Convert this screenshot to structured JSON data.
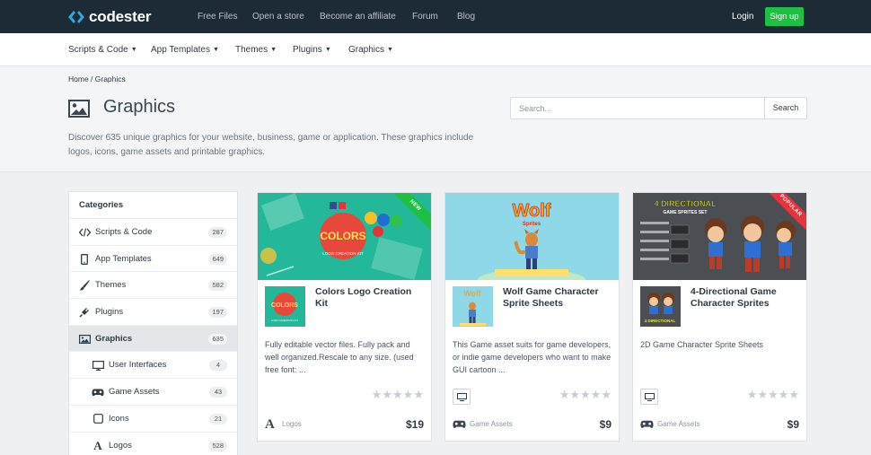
{
  "brand": {
    "name": "codester"
  },
  "topnav": [
    "Free Files",
    "Open a store",
    "Become an affiliate",
    "Forum",
    "Blog"
  ],
  "auth": {
    "login": "Login",
    "signup": "Sign up"
  },
  "menu": [
    "Scripts & Code",
    "App Templates",
    "Themes",
    "Plugins",
    "Graphics"
  ],
  "breadcrumb": "Home / Graphics",
  "page": {
    "title": "Graphics",
    "description": "Discover 635 unique graphics for your website, business, game or application. These graphics include logos, icons, game assets and printable graphics."
  },
  "search": {
    "placeholder": "Search...",
    "button": "Search"
  },
  "sidebar": {
    "title": "Categories",
    "items": [
      {
        "label": "Scripts & Code",
        "count": "287",
        "icon": "code-icon"
      },
      {
        "label": "App Templates",
        "count": "649",
        "icon": "mobile-icon"
      },
      {
        "label": "Themes",
        "count": "582",
        "icon": "brush-icon"
      },
      {
        "label": "Plugins",
        "count": "197",
        "icon": "plug-icon"
      },
      {
        "label": "Graphics",
        "count": "635",
        "icon": "image-icon"
      },
      {
        "label": "User Interfaces",
        "count": "4",
        "icon": "monitor-icon"
      },
      {
        "label": "Game Assets",
        "count": "43",
        "icon": "gamepad-icon"
      },
      {
        "label": "Icons",
        "count": "21",
        "icon": "square-icon"
      },
      {
        "label": "Logos",
        "count": "528",
        "icon": "font-icon"
      }
    ]
  },
  "cards": [
    {
      "title": "Colors Logo Creation Kit",
      "description": "Fully editable vector files. Fully pack and well organized.Rescale to any size. (used free font: ...",
      "category": "Logos",
      "price": "$19",
      "badge": "NEW",
      "banner_word": "COLORS",
      "banner_sub": "LOGO CREATION KIT",
      "rating": 0
    },
    {
      "title": "Wolf Game Character Sprite Sheets",
      "description": "This Game asset suits for game developers, or indie game developers who want to make GUI cartoon ...",
      "category": "Game Assets",
      "price": "$9",
      "badge": "",
      "banner_word": "Wolf",
      "banner_sub": "Sprites",
      "rating": 0
    },
    {
      "title": "4-Directional Game Character Sprites",
      "description": "2D Game Character Sprite Sheets",
      "category": "Game Assets",
      "price": "$9",
      "badge": "POPULAR",
      "banner_word": "4 DIRECTIONAL",
      "banner_sub": "GAME SPRITES SET",
      "rating": 0
    }
  ],
  "stars": "★★★★★",
  "colors": {
    "topbar": "#1d2b36",
    "signup": "#1ec044",
    "new_ribbon": "#1ec044",
    "popular_ribbon": "#e8323c"
  }
}
